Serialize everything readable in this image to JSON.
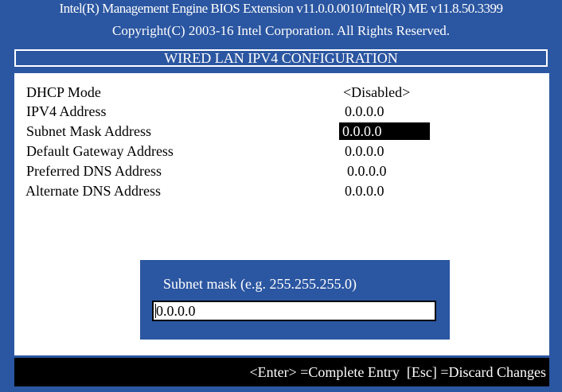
{
  "header": {
    "line1": "Intel(R) Management Engine BIOS Extension v11.0.0.0010/Intel(R) ME v11.8.50.3399",
    "line2": "Copyright(C) 2003-16 Intel Corporation. All Rights Reserved.",
    "title": "WIRED LAN IPV4 CONFIGURATION"
  },
  "settings": [
    {
      "label": "DHCP Mode",
      "value": "<Disabled>"
    },
    {
      "label": "IPV4 Address",
      "value": "0.0.0.0"
    },
    {
      "label": "Subnet Mask Address",
      "value": "0.0.0.0"
    },
    {
      "label": "Default Gateway Address",
      "value": "0.0.0.0"
    },
    {
      "label": "Preferred DNS Address",
      "value": "0.0.0.0"
    },
    {
      "label": "Alternate DNS Address",
      "value": "0.0.0.0"
    }
  ],
  "dialog": {
    "prompt": "Subnet mask (e.g. 255.255.255.0)",
    "input_value": "0.0.0.0"
  },
  "footer": {
    "hint": "<Enter> =Complete Entry  [Esc] =Discard Changes"
  },
  "colors": {
    "background_blue": "#2b56a1",
    "text_white": "#ffffff",
    "selection_black": "#000000"
  }
}
